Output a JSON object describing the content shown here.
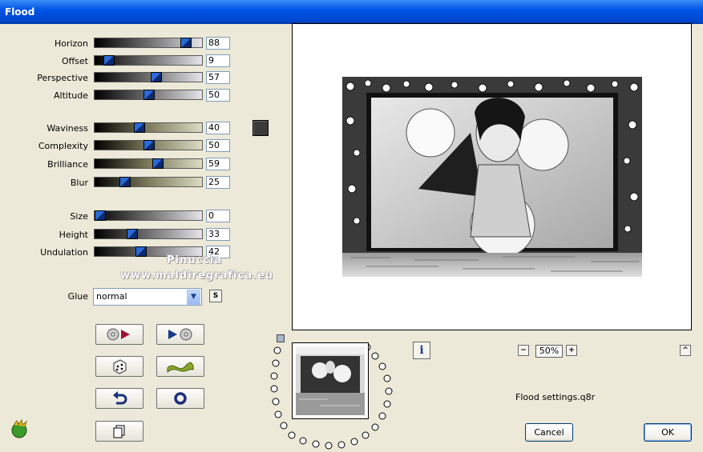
{
  "window": {
    "title": "Flood"
  },
  "params": [
    {
      "label": "Horizon",
      "value": "88",
      "fraction": 0.88,
      "track": "gray"
    },
    {
      "label": "Offset",
      "value": "9",
      "fraction": 0.09,
      "track": "gray"
    },
    {
      "label": "Perspective",
      "value": "57",
      "fraction": 0.57,
      "track": "gray"
    },
    {
      "label": "Altitude",
      "value": "50",
      "fraction": 0.5,
      "track": "gray"
    },
    {
      "label": "Waviness",
      "value": "40",
      "fraction": 0.4,
      "track": "green"
    },
    {
      "label": "Complexity",
      "value": "50",
      "fraction": 0.5,
      "track": "green"
    },
    {
      "label": "Brilliance",
      "value": "59",
      "fraction": 0.59,
      "track": "green"
    },
    {
      "label": "Blur",
      "value": "25",
      "fraction": 0.25,
      "track": "green"
    },
    {
      "label": "Size",
      "value": "0",
      "fraction": 0.0,
      "track": "gray"
    },
    {
      "label": "Height",
      "value": "33",
      "fraction": 0.33,
      "track": "gray"
    },
    {
      "label": "Undulation",
      "value": "42",
      "fraction": 0.42,
      "track": "gray"
    }
  ],
  "color_swatch": "#3a3a3a",
  "glue": {
    "label": "Glue",
    "value": "normal",
    "options_button": "S"
  },
  "watermark": {
    "line1": "Pinuccia",
    "line2": "www.maldiregrafica.eu"
  },
  "tools": [
    {
      "name": "load-preset",
      "icon": "disc-arrow-icon"
    },
    {
      "name": "save-preset",
      "icon": "arrow-disc-icon"
    },
    {
      "name": "random",
      "icon": "dice-icon"
    },
    {
      "name": "wave",
      "icon": "wave-icon"
    },
    {
      "name": "reset",
      "icon": "undo-icon"
    },
    {
      "name": "ring",
      "icon": "ring-icon"
    },
    {
      "name": "copy",
      "icon": "copy-icon"
    }
  ],
  "info_button": "i",
  "zoom": {
    "minus": "−",
    "value": "50%",
    "plus": "+",
    "collapse": "^"
  },
  "status_text": "Flood settings.q8r",
  "buttons": {
    "cancel": "Cancel",
    "ok": "OK"
  },
  "colors": {
    "title_bar": "#0055e5",
    "dialog_bg": "#ece9d8",
    "slider_thumb": "#2a6ad8"
  }
}
